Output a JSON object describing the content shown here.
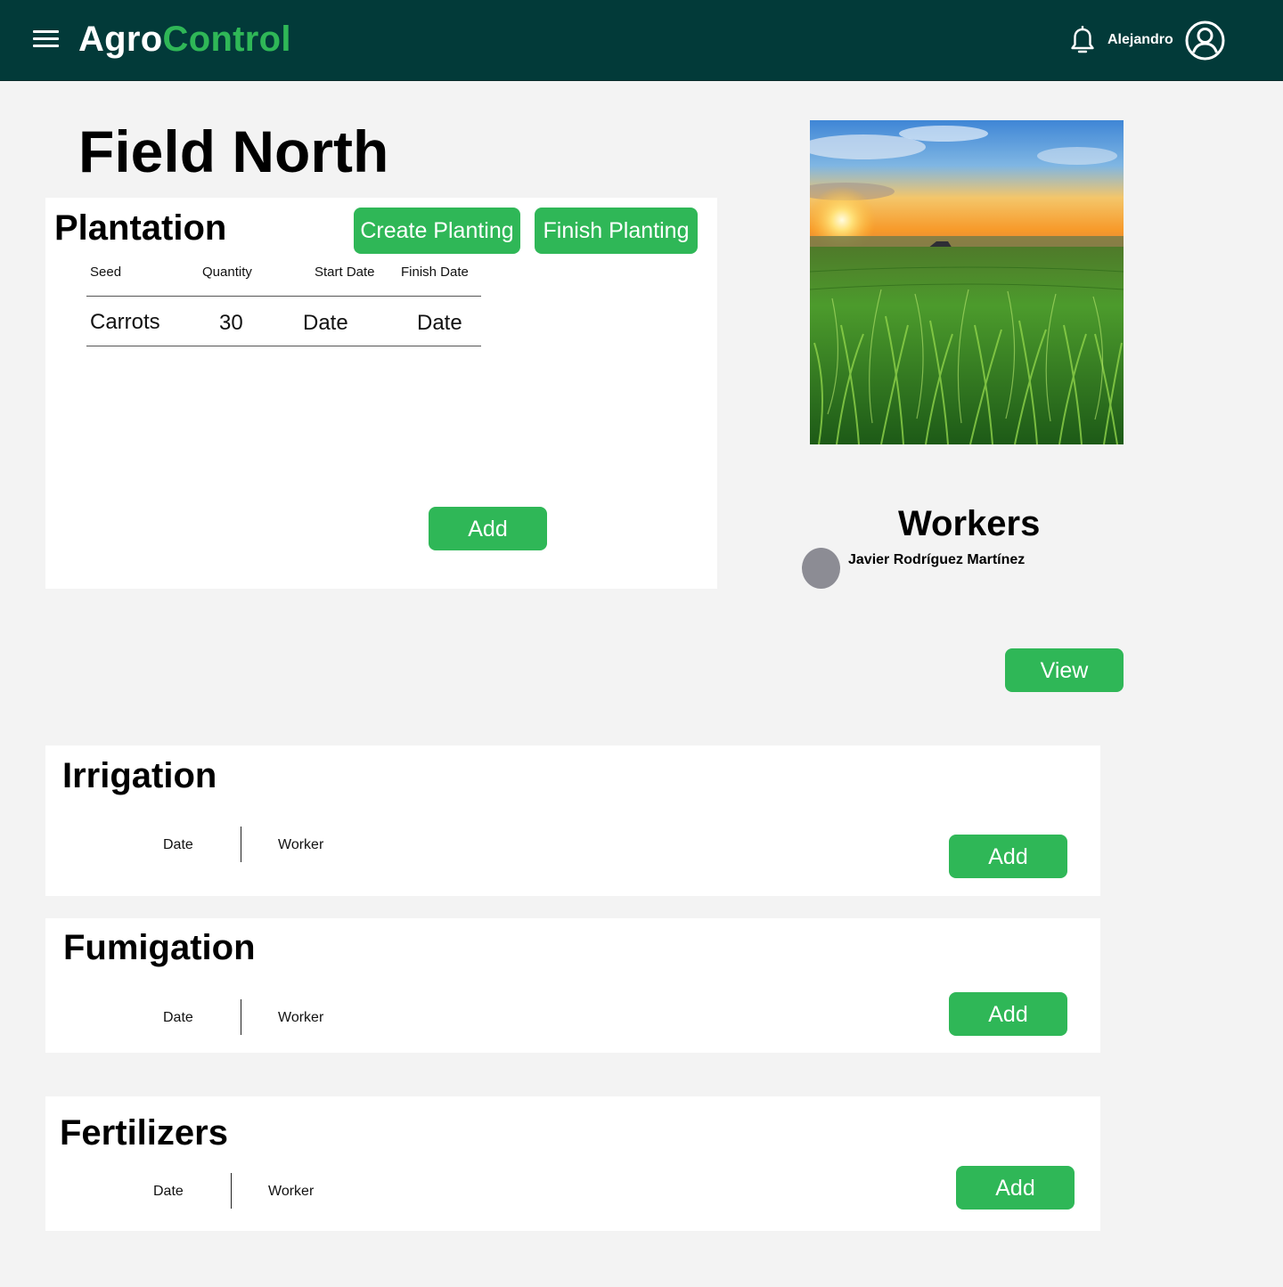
{
  "header": {
    "brand_part1": "Agro",
    "brand_part2": "Control",
    "username": "Alejandro",
    "menu_icon": "hamburger-menu-icon",
    "notification_icon": "bell-icon",
    "profile_icon": "user-circle-icon"
  },
  "page": {
    "title": "Field North"
  },
  "plantation": {
    "title": "Plantation",
    "create_label": "Create Planting",
    "finish_label": "Finish Planting",
    "columns": [
      "Seed",
      "Quantity",
      "Start Date",
      "Finish Date"
    ],
    "rows": [
      {
        "seed": "Carrots",
        "quantity": "30",
        "start": "Date",
        "finish": "Date"
      }
    ],
    "add_label": "Add"
  },
  "workers": {
    "title": "Workers",
    "list": [
      {
        "name": "Javier Rodríguez Martínez"
      }
    ],
    "view_label": "View"
  },
  "irrigation": {
    "title": "Irrigation",
    "col_date": "Date",
    "col_worker": "Worker",
    "add_label": "Add"
  },
  "fumigation": {
    "title": "Fumigation",
    "col_date": "Date",
    "col_worker": "Worker",
    "add_label": "Add"
  },
  "fertilizers": {
    "title": "Fertilizers",
    "col_date": "Date",
    "col_worker": "Worker",
    "add_label": "Add"
  },
  "colors": {
    "header_bg": "#023a39",
    "accent": "#2fb757",
    "page_bg": "#f3f3f3"
  }
}
